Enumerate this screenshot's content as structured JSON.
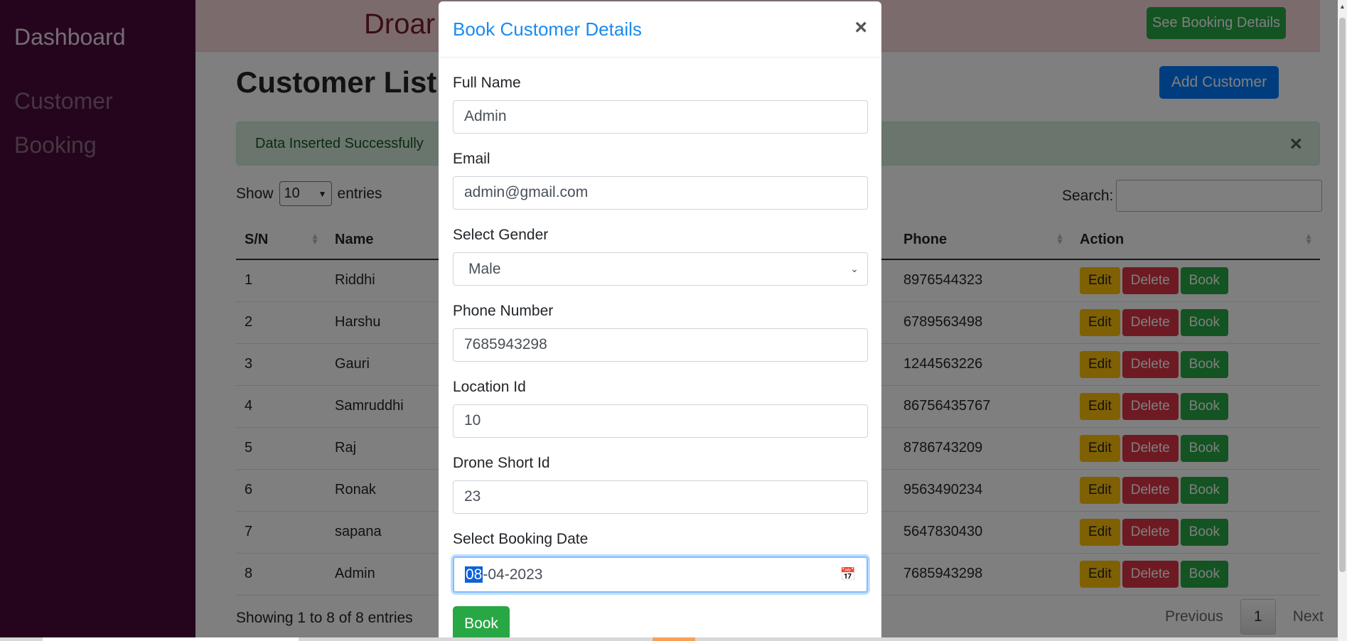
{
  "sidebar": {
    "brand": "Dashboard",
    "items": [
      {
        "label": "Customer"
      },
      {
        "label": "Booking"
      }
    ]
  },
  "topbar": {
    "site_title": "Droar",
    "see_booking_label": "See Booking Details"
  },
  "page": {
    "title": "Customer List",
    "add_customer_label": "Add Customer",
    "alert_text": "Data Inserted Successfully",
    "alert_close": "×",
    "show_label": "Show",
    "entries_label": "entries",
    "entries_value": "10",
    "search_label": "Search:"
  },
  "table": {
    "headers": {
      "sn": "S/N",
      "name": "Name",
      "phone": "Phone",
      "action": "Action"
    },
    "rows": [
      {
        "sn": "1",
        "name": "Riddhi",
        "phone": "8976544323"
      },
      {
        "sn": "2",
        "name": "Harshu",
        "phone": "6789563498"
      },
      {
        "sn": "3",
        "name": "Gauri",
        "phone": "1244563226"
      },
      {
        "sn": "4",
        "name": "Samruddhi",
        "phone": "86756435767"
      },
      {
        "sn": "5",
        "name": "Raj",
        "phone": "8786743209"
      },
      {
        "sn": "6",
        "name": "Ronak",
        "phone": "9563490234"
      },
      {
        "sn": "7",
        "name": "sapana",
        "phone": "5647830430"
      },
      {
        "sn": "8",
        "name": "Admin",
        "phone": "7685943298"
      }
    ],
    "actions": {
      "edit": "Edit",
      "delete": "Delete",
      "book": "Book"
    }
  },
  "footer": {
    "info": "Showing 1 to 8 of 8 entries",
    "previous": "Previous",
    "page": "1",
    "next": "Next"
  },
  "modal": {
    "title": "Book Customer Details",
    "close": "×",
    "fields": {
      "full_name": {
        "label": "Full Name",
        "value": "Admin"
      },
      "email": {
        "label": "Email",
        "value": "admin@gmail.com"
      },
      "gender": {
        "label": "Select Gender",
        "value": "Male"
      },
      "phone": {
        "label": "Phone Number",
        "value": "7685943298"
      },
      "location": {
        "label": "Location Id",
        "value": "10"
      },
      "drone": {
        "label": "Drone Short Id",
        "value": "23"
      },
      "date": {
        "label": "Select Booking Date",
        "day": "08",
        "rest": "-04-2023"
      }
    },
    "submit_label": "Book"
  },
  "colors": {
    "sidebar": "#4a0a3a",
    "primary": "#007bff",
    "success": "#28a745",
    "danger": "#dc3545",
    "warning": "#ffc107"
  }
}
